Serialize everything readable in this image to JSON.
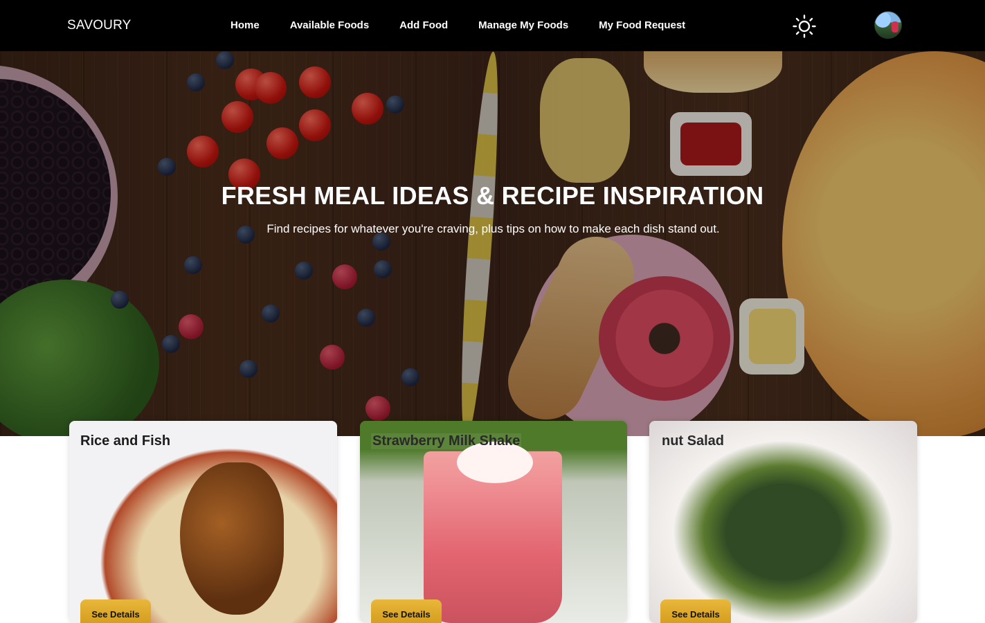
{
  "navbar": {
    "brand": "SAVOURY",
    "links": [
      "Home",
      "Available Foods",
      "Add Food",
      "Manage My Foods",
      "My Food Request"
    ],
    "theme_icon": "sun-icon",
    "avatar_icon": "user-avatar"
  },
  "hero": {
    "title": "FRESH MEAL IDEAS & RECIPE INSPIRATION",
    "subtitle": "Find recipes for whatever you're craving, plus tips on how to make each dish stand out."
  },
  "cards": [
    {
      "title": "Rice and Fish",
      "button": "See Details"
    },
    {
      "title": "Strawberry Milk Shake",
      "button": "See Details"
    },
    {
      "title": "nut Salad",
      "button": "See Details"
    }
  ],
  "colors": {
    "navbar_bg": "#000000",
    "button_accent": "#e0ab2c"
  }
}
